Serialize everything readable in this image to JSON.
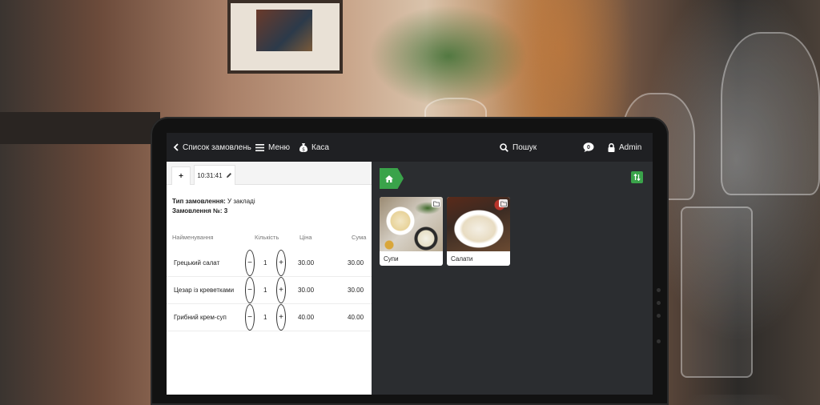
{
  "topbar": {
    "back_label": "Список замовлень",
    "menu_label": "Меню",
    "cash_label": "Каса",
    "search_label": "Пошук",
    "notification_count": "0",
    "user_label": "Admin"
  },
  "order_tabs": {
    "add_label": "+",
    "time": "10:31:41"
  },
  "order": {
    "type_label": "Тип замовлення:",
    "type_value": "У закладі",
    "number_label": "Замовлення №:",
    "number_value": "3"
  },
  "table": {
    "columns": [
      "Найменування",
      "Кількість",
      "Ціна",
      "Сума"
    ],
    "rows": [
      {
        "name": "Грецький салат",
        "qty": "1",
        "price": "30.00",
        "sum": "30.00"
      },
      {
        "name": "Цезар із креветками",
        "qty": "1",
        "price": "30.00",
        "sum": "30.00"
      },
      {
        "name": "Грибний крем-суп",
        "qty": "1",
        "price": "40.00",
        "sum": "40.00"
      }
    ]
  },
  "categories": [
    {
      "label": "Супи",
      "icon": "folder-icon"
    },
    {
      "label": "Салати",
      "icon": "folder-icon"
    }
  ],
  "colors": {
    "accent_green": "#3aa34a",
    "topbar_bg": "#1f2023",
    "panel_bg": "#2b2d30"
  }
}
